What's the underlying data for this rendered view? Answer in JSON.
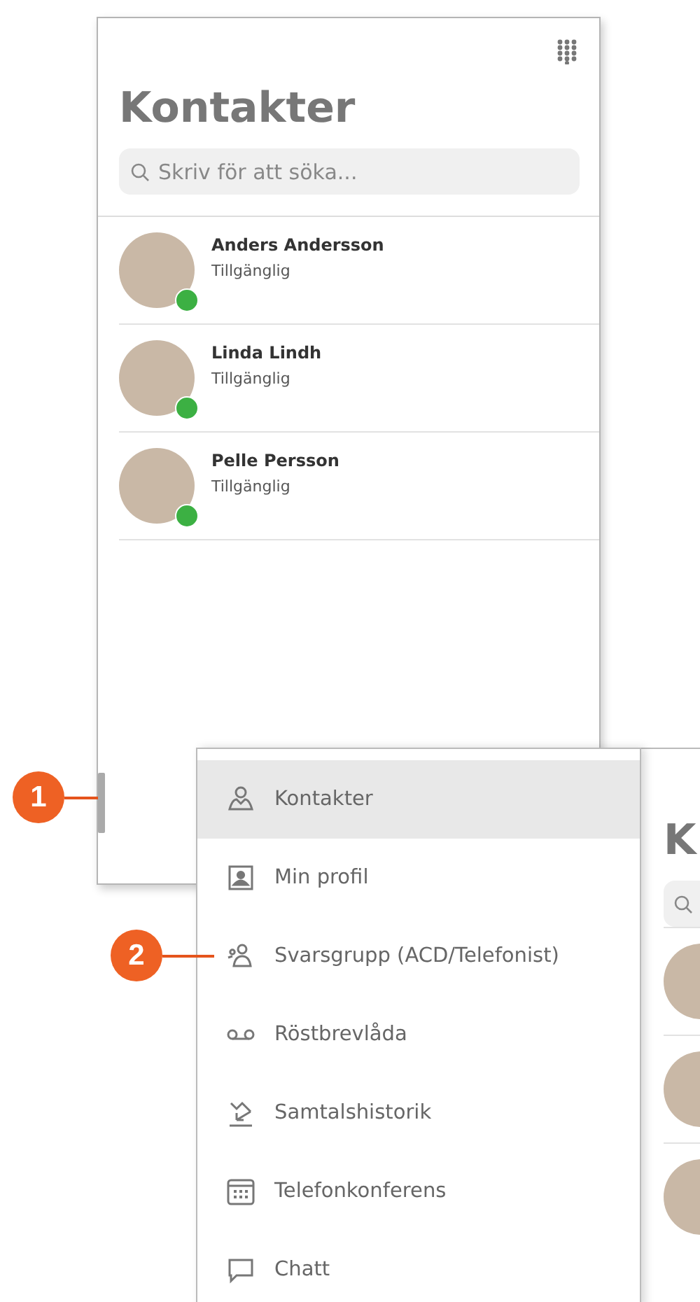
{
  "screen": {
    "title": "Kontakter",
    "search": {
      "placeholder": "Skriv för att söka..."
    },
    "contacts": [
      {
        "name": "Anders Andersson",
        "status": "Tillgänglig"
      },
      {
        "name": "Linda Lindh",
        "status": "Tillgänglig"
      },
      {
        "name": "Pelle Persson",
        "status": "Tillgänglig"
      }
    ]
  },
  "menu": {
    "items": [
      {
        "label": "Kontakter",
        "kind": "person",
        "selected": true
      },
      {
        "label": "Min profil",
        "kind": "profile",
        "selected": false
      },
      {
        "label": "Svarsgrupp (ACD/Telefonist)",
        "kind": "group",
        "selected": false
      },
      {
        "label": "Röstbrevlåda",
        "kind": "voicemail",
        "selected": false
      },
      {
        "label": "Samtalshistorik",
        "kind": "history",
        "selected": false
      },
      {
        "label": "Telefonkonferens",
        "kind": "conference",
        "selected": false
      },
      {
        "label": "Chatt",
        "kind": "chat",
        "selected": false
      }
    ]
  },
  "background_screen": {
    "title": "K"
  },
  "callouts": [
    {
      "number": "1"
    },
    {
      "number": "2"
    }
  ]
}
